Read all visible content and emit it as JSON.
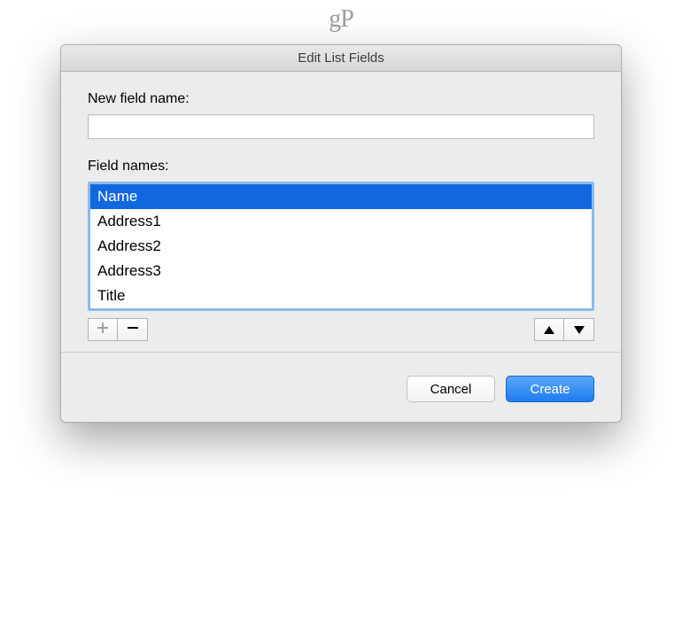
{
  "watermark": "gP",
  "dialog": {
    "title": "Edit List Fields",
    "new_field_label": "New field name:",
    "new_field_value": "",
    "field_names_label": "Field names:",
    "field_names": [
      {
        "label": "Name",
        "selected": true
      },
      {
        "label": "Address1",
        "selected": false
      },
      {
        "label": "Address2",
        "selected": false
      },
      {
        "label": "Address3",
        "selected": false
      },
      {
        "label": "Title",
        "selected": false
      }
    ],
    "buttons": {
      "cancel": "Cancel",
      "create": "Create"
    }
  }
}
